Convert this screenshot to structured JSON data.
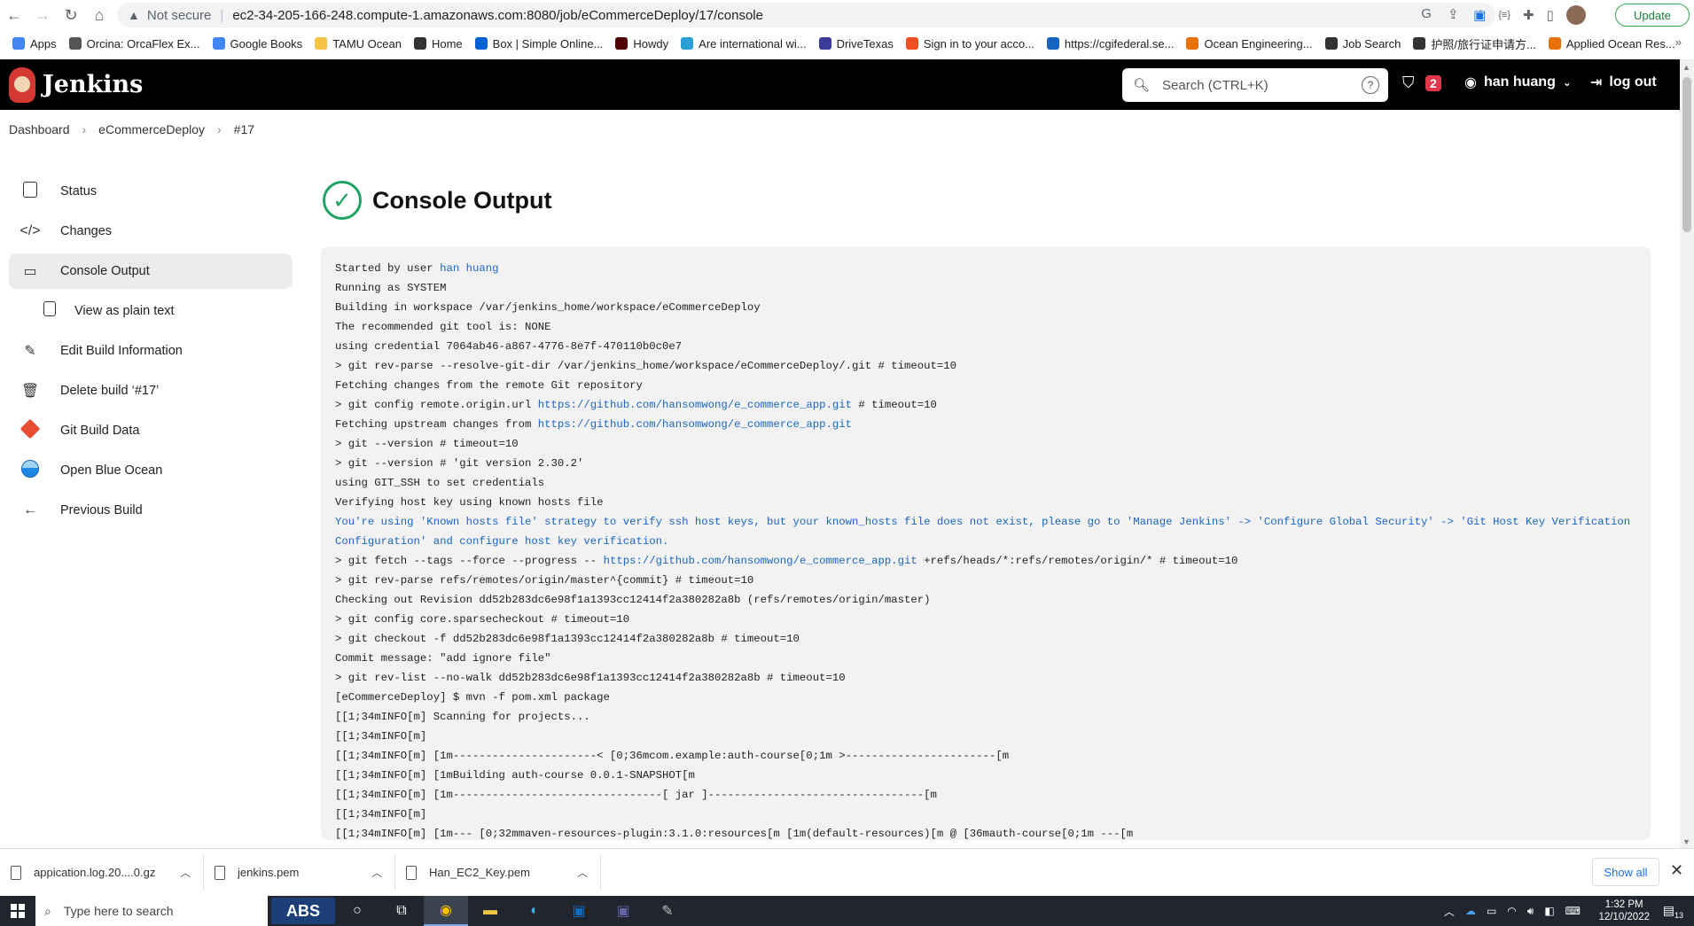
{
  "browser": {
    "address_warning": "Not secure",
    "url": "ec2-34-205-166-248.compute-1.amazonaws.com:8080/job/eCommerceDeploy/17/console",
    "update_label": "Update",
    "bookmarks": [
      {
        "label": "Apps",
        "color": "#4285f4"
      },
      {
        "label": "Orcina: OrcaFlex Ex...",
        "color": "#555555"
      },
      {
        "label": "Google Books",
        "color": "#4285f4"
      },
      {
        "label": "TAMU Ocean",
        "color": "#f6c344"
      },
      {
        "label": "Home",
        "color": "#333333"
      },
      {
        "label": "Box | Simple Online...",
        "color": "#0061d5"
      },
      {
        "label": "Howdy",
        "color": "#500000"
      },
      {
        "label": "Are international wi...",
        "color": "#2a9fd6"
      },
      {
        "label": "DriveTexas",
        "color": "#3b3b9a"
      },
      {
        "label": "Sign in to your acco...",
        "color": "#f25022"
      },
      {
        "label": "https://cgifederal.se...",
        "color": "#1565c0"
      },
      {
        "label": "Ocean Engineering...",
        "color": "#e8710a"
      },
      {
        "label": "Job Search",
        "color": "#333333"
      },
      {
        "label": "护照/旅行证申请方...",
        "color": "#333333"
      },
      {
        "label": "Applied Ocean Res...",
        "color": "#e8710a"
      }
    ]
  },
  "jenkins": {
    "logo_text": "Jenkins",
    "search_placeholder": "Search (CTRL+K)",
    "alert_count": "2",
    "user_name": "han huang",
    "logout_label": "log out"
  },
  "breadcrumb": [
    "Dashboard",
    "eCommerceDeploy",
    "#17"
  ],
  "sidebar": [
    {
      "label": "Status"
    },
    {
      "label": "Changes"
    },
    {
      "label": "Console Output"
    },
    {
      "label": "View as plain text"
    },
    {
      "label": "Edit Build Information"
    },
    {
      "label": "Delete build ‘#17’"
    },
    {
      "label": "Git Build Data"
    },
    {
      "label": "Open Blue Ocean"
    },
    {
      "label": "Previous Build"
    }
  ],
  "main": {
    "title": "Console Output",
    "console_lines": [
      {
        "pre": "Started by user ",
        "link": "han huang",
        "post": ""
      },
      {
        "pre": "Running as SYSTEM",
        "link": "",
        "post": ""
      },
      {
        "pre": "Building in workspace /var/jenkins_home/workspace/eCommerceDeploy",
        "link": "",
        "post": ""
      },
      {
        "pre": "The recommended git tool is: NONE",
        "link": "",
        "post": ""
      },
      {
        "pre": "using credential 7064ab46-a867-4776-8e7f-470110b0c0e7",
        "link": "",
        "post": ""
      },
      {
        "pre": " > git rev-parse --resolve-git-dir /var/jenkins_home/workspace/eCommerceDeploy/.git # timeout=10",
        "link": "",
        "post": ""
      },
      {
        "pre": "Fetching changes from the remote Git repository",
        "link": "",
        "post": ""
      },
      {
        "pre": " > git config remote.origin.url ",
        "link": "https://github.com/hansomwong/e_commerce_app.git",
        "post": " # timeout=10"
      },
      {
        "pre": "Fetching upstream changes from ",
        "link": "https://github.com/hansomwong/e_commerce_app.git",
        "post": ""
      },
      {
        "pre": " > git --version # timeout=10",
        "link": "",
        "post": ""
      },
      {
        "pre": " > git --version # 'git version 2.30.2'",
        "link": "",
        "post": ""
      },
      {
        "pre": "using GIT_SSH to set credentials",
        "link": "",
        "post": ""
      },
      {
        "pre": "Verifying host key using known hosts file",
        "link": "",
        "post": ""
      },
      {
        "pre": "",
        "link": "You're using 'Known hosts file' strategy to verify ssh host keys, but your known_hosts file does not exist, please go to 'Manage Jenkins' -> 'Configure Global Security' -> 'Git Host Key Verification Configuration' and configure host key verification.",
        "post": ""
      },
      {
        "pre": " > git fetch --tags --force --progress -- ",
        "link": "https://github.com/hansomwong/e_commerce_app.git",
        "post": " +refs/heads/*:refs/remotes/origin/* # timeout=10"
      },
      {
        "pre": " > git rev-parse refs/remotes/origin/master^{commit} # timeout=10",
        "link": "",
        "post": ""
      },
      {
        "pre": "Checking out Revision dd52b283dc6e98f1a1393cc12414f2a380282a8b (refs/remotes/origin/master)",
        "link": "",
        "post": ""
      },
      {
        "pre": " > git config core.sparsecheckout # timeout=10",
        "link": "",
        "post": ""
      },
      {
        "pre": " > git checkout -f dd52b283dc6e98f1a1393cc12414f2a380282a8b # timeout=10",
        "link": "",
        "post": ""
      },
      {
        "pre": "Commit message: \"add ignore file\"",
        "link": "",
        "post": ""
      },
      {
        "pre": " > git rev-list --no-walk dd52b283dc6e98f1a1393cc12414f2a380282a8b # timeout=10",
        "link": "",
        "post": ""
      },
      {
        "pre": "[eCommerceDeploy] $ mvn -f pom.xml package",
        "link": "",
        "post": ""
      },
      {
        "pre": "[\u0018[1;34mINFO\u0018[m] Scanning for projects...",
        "link": "",
        "post": ""
      },
      {
        "pre": "[\u0018[1;34mINFO\u0018[m]",
        "link": "",
        "post": ""
      },
      {
        "pre": "[\u0018[1;34mINFO\u0018[m] \u0018[1m----------------------< \u0018[0;36mcom.example:auth-course\u0018[0;1m >-----------------------\u0018[m",
        "link": "",
        "post": ""
      },
      {
        "pre": "[\u0018[1;34mINFO\u0018[m] \u0018[1mBuilding auth-course 0.0.1-SNAPSHOT\u0018[m",
        "link": "",
        "post": ""
      },
      {
        "pre": "[\u0018[1;34mINFO\u0018[m] \u0018[1m--------------------------------[ jar ]---------------------------------\u0018[m",
        "link": "",
        "post": ""
      },
      {
        "pre": "[\u0018[1;34mINFO\u0018[m]",
        "link": "",
        "post": ""
      },
      {
        "pre": "[\u0018[1;34mINFO\u0018[m] \u0018[1m--- \u0018[0;32mmaven-resources-plugin:3.1.0:resources\u0018[m \u0018[1m(default-resources)\u0018[m @ \u0018[36mauth-course\u0018[0;1m ---\u0018[m",
        "link": "",
        "post": ""
      }
    ]
  },
  "downloads": {
    "items": [
      "appication.log.20....0.gz",
      "jenkins.pem",
      "Han_EC2_Key.pem"
    ],
    "show_all": "Show all"
  },
  "taskbar": {
    "search_placeholder": "Type here to search",
    "abs_label": "ABS",
    "time": "1:32 PM",
    "date": "12/10/2022",
    "notification_count": "13"
  }
}
